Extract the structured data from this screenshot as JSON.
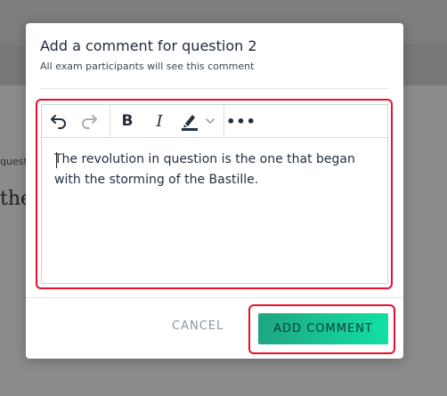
{
  "background": {
    "question_label": "quest",
    "question_text": "the"
  },
  "modal": {
    "title": "Add a comment for question 2",
    "subtitle": "All exam participants will see this comment"
  },
  "toolbar": {
    "items": [
      {
        "name": "undo",
        "icon": "undo-icon"
      },
      {
        "name": "redo",
        "icon": "redo-icon",
        "disabled": true
      },
      {
        "name": "bold",
        "label": "B"
      },
      {
        "name": "italic",
        "label": "I"
      },
      {
        "name": "highlight",
        "icon": "highlighter-icon"
      },
      {
        "name": "more",
        "label": "•••"
      }
    ]
  },
  "editor": {
    "text": "The revolution in question is the one that began with the storming of the Bastille."
  },
  "footer": {
    "cancel_label": "CANCEL",
    "add_label": "ADD COMMENT"
  },
  "colors": {
    "accent_start": "#1fa583",
    "accent_end": "#12e0a2",
    "highlight_border": "#e8102b",
    "cancel_text": "#8a97a3"
  }
}
